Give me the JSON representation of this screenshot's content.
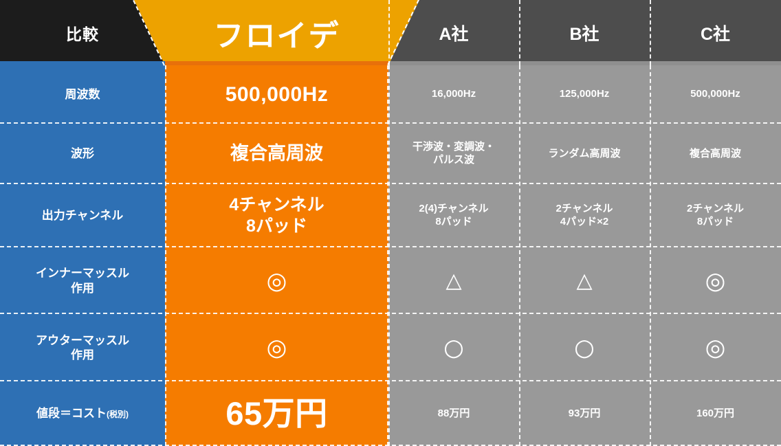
{
  "header": {
    "label": "比較",
    "hero": "フロイデ",
    "competitors": [
      "A社",
      "B社",
      "C社"
    ]
  },
  "colors": {
    "label_header_bg": "#1C1C1C",
    "hero_header_bg": "#EDA200",
    "competitor_header_bg": "#4D4D4D",
    "label_bg": "#2E70B4",
    "hero_bg": "#F57C00",
    "competitor_bg": "#999999",
    "separator": "#FFFFFF"
  },
  "rows": [
    {
      "label": "周波数",
      "label_sub": "",
      "hero": "500,000Hz",
      "hero_lines": [
        "500,000Hz"
      ],
      "a": [
        "16,000Hz"
      ],
      "b": [
        "125,000Hz"
      ],
      "c": [
        "500,000Hz"
      ]
    },
    {
      "label": "波形",
      "label_sub": "",
      "hero": "複合高周波",
      "hero_lines": [
        "複合高周波"
      ],
      "a": [
        "干渉波・変調波・",
        "パルス波"
      ],
      "b": [
        "ランダム高周波"
      ],
      "c": [
        "複合高周波"
      ]
    },
    {
      "label": "出力チャンネル",
      "label_sub": "",
      "hero": "4チャンネル 8パッド",
      "hero_lines": [
        "4チャンネル",
        "8パッド"
      ],
      "a": [
        "2(4)チャンネル",
        "8パッド"
      ],
      "b": [
        "2チャンネル",
        "4パッド×2"
      ],
      "c": [
        "2チャンネル",
        "8パッド"
      ]
    },
    {
      "label": "インナーマッスル",
      "label_sub": "作用",
      "hero": "◎",
      "hero_lines": [
        "◎"
      ],
      "a": [
        "△"
      ],
      "b": [
        "△"
      ],
      "c": [
        "◎"
      ]
    },
    {
      "label": "アウターマッスル",
      "label_sub": "作用",
      "hero": "◎",
      "hero_lines": [
        "◎"
      ],
      "a": [
        "○"
      ],
      "b": [
        "○"
      ],
      "c": [
        "◎"
      ]
    },
    {
      "label": "値段＝コスト",
      "label_sub": "(税別)",
      "hero": "65万円",
      "hero_lines": [
        "65万円"
      ],
      "a": [
        "88万円"
      ],
      "b": [
        "93万円"
      ],
      "c": [
        "160万円"
      ]
    }
  ]
}
